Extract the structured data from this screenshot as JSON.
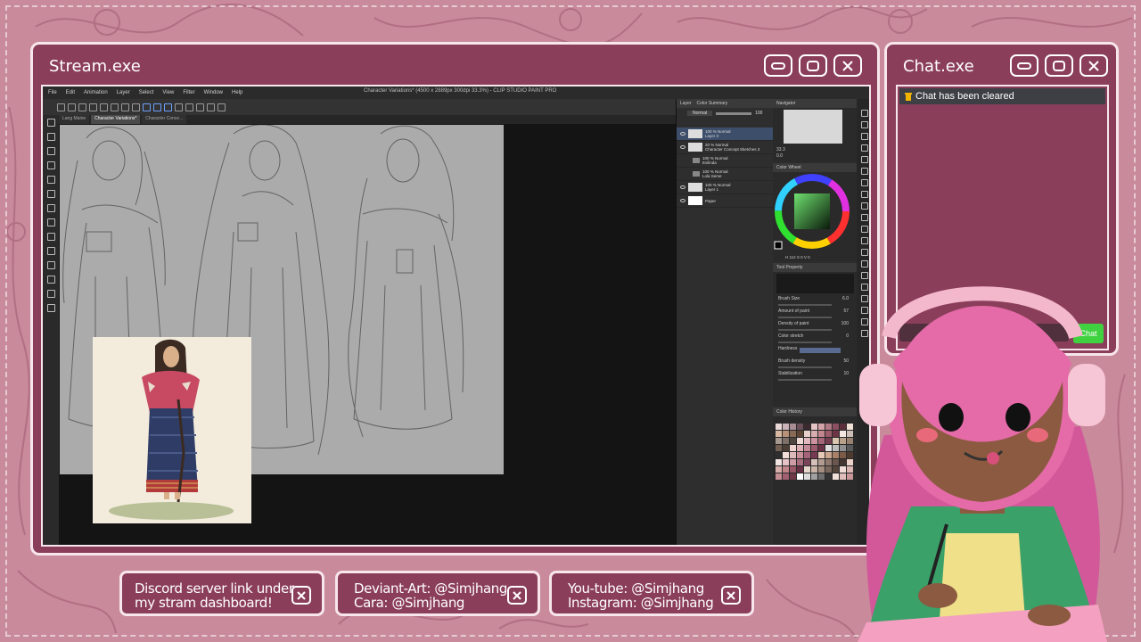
{
  "stream_window": {
    "title": "Stream.exe"
  },
  "chat_window": {
    "title": "Chat.exe",
    "notice": "Chat has been cleared",
    "send_label": "Chat"
  },
  "csp": {
    "menu": [
      "File",
      "Edit",
      "Animation",
      "Layer",
      "Select",
      "View",
      "Filter",
      "Window",
      "Help"
    ],
    "app_title": "Character Variations* (4500 x 2889px 300dpi 33.3%) - CLIP STUDIO PAINT PRO",
    "tabs": [
      "Lang Maine",
      "Character Variations*",
      "Character Conce..."
    ],
    "layer_panel_tabs": [
      "Layer",
      "Color Summary"
    ],
    "blend_mode": "Normal",
    "opacity": "100",
    "layers": [
      {
        "l1": "100 % Normal",
        "l2": "Layer 3"
      },
      {
        "l1": "20 % Normal",
        "l2": "Character Concept Sketches 3"
      },
      {
        "l1": "100 % Normal",
        "l2": "Evilinda"
      },
      {
        "l1": "100 % Normal",
        "l2": "Lola Seme"
      },
      {
        "l1": "100 % Normal",
        "l2": "Layer 1"
      },
      {
        "l1": "",
        "l2": "Paper"
      }
    ],
    "navigator_label": "Navigator",
    "zoom": "33.3",
    "rotation": "0.0",
    "color_wheel_label": "Color Wheel",
    "color_values": "H 112  S 0  V 0",
    "tool_property_label": "Tool Property",
    "properties": [
      {
        "label": "Brush Size",
        "value": "6.0"
      },
      {
        "label": "Amount of paint",
        "value": "57"
      },
      {
        "label": "Density of paint",
        "value": "100"
      },
      {
        "label": "Color stretch",
        "value": "0"
      },
      {
        "label": "Hardness",
        "value": ""
      },
      {
        "label": "Brush density",
        "value": "50"
      },
      {
        "label": "Stabilization",
        "value": "10"
      }
    ],
    "color_history_label": "Color History",
    "swatches": [
      "#e8d8d8",
      "#c9b2b8",
      "#a88d95",
      "#6b5059",
      "#3a2a30",
      "#e4c4c4",
      "#d1a3a8",
      "#b07a85",
      "#8c5060",
      "#5b2f3c",
      "#f0e0d4",
      "#d8b8a0",
      "#b89278",
      "#8a6a55",
      "#5e4535",
      "#e9cfc9",
      "#d7adb0",
      "#c2868f",
      "#9c5c6a",
      "#6d3445",
      "#f4e7e2",
      "#cdbfb7",
      "#a79990",
      "#7e7068",
      "#504640",
      "#efd9d4",
      "#e2b7bd",
      "#cc92a0",
      "#a6667a",
      "#743d50",
      "#d9c5b0",
      "#b9a08a",
      "#978070",
      "#725f52",
      "#4b3e35",
      "#eed5cf",
      "#dcb0b5",
      "#c48999",
      "#9b5a6e",
      "#6a3246",
      "#e0e0e0",
      "#bdbdbd",
      "#8f8f8f",
      "#5a5a5a",
      "#2e2e2e",
      "#f2dfd8",
      "#deb9bb",
      "#c99199",
      "#a4637a",
      "#753a52",
      "#e7c9b7",
      "#cda68f",
      "#a98068",
      "#7b5a47",
      "#4e3a2e",
      "#f3e4e3",
      "#e4c2c5",
      "#cd9ca5",
      "#a86e7e",
      "#7a4358",
      "#d4c0b8",
      "#b29c92",
      "#8f786e",
      "#6a564d",
      "#43352f",
      "#ecd2c8",
      "#d8aeaa",
      "#c18489",
      "#985667",
      "#683044",
      "#e6d6cc",
      "#c8b3a6",
      "#a48e80",
      "#7a675b",
      "#52443b",
      "#efdcd6",
      "#ddb7b4",
      "#c58e93",
      "#a06072",
      "#6f3849",
      "#ffffff",
      "#dcdcdc",
      "#a0a0a0",
      "#6e6e6e",
      "#333333",
      "#f1e2dc",
      "#dfbdbc",
      "#c89699"
    ]
  },
  "cards": [
    {
      "line1": "Discord server link under",
      "line2": "my stram dashboard!"
    },
    {
      "line1": "Deviant-Art: @Simjhang",
      "line2": "Cara: @Simjhang"
    },
    {
      "line1": "You-tube: @Simjhang",
      "line2": "Instagram: @Simjhang"
    }
  ],
  "colors": {
    "frame": "#8b3e5a",
    "frame_border": "#f7e6ec",
    "background": "#c98a9b",
    "chat_send": "#3fd13f"
  }
}
